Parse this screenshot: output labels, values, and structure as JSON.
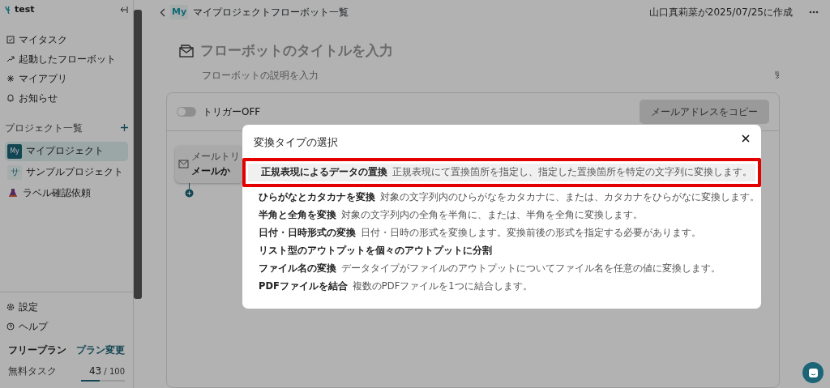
{
  "sidebar": {
    "workspace": "test",
    "nav": [
      {
        "label": "マイタスク"
      },
      {
        "label": "起動したフローボット"
      },
      {
        "label": "マイアプリ"
      },
      {
        "label": "お知らせ"
      }
    ],
    "projects_heading": "プロジェクト一覧",
    "projects": [
      {
        "kind": "badge",
        "badge": "My",
        "label": "マイプロジェクト",
        "selected": true
      },
      {
        "kind": "badge",
        "badge": "サ",
        "label": "サンプルプロジェクト",
        "selected": false
      },
      {
        "kind": "icon",
        "label": "ラベル確認依頼",
        "selected": false
      }
    ],
    "bottom": [
      {
        "label": "設定"
      },
      {
        "label": "ヘルプ"
      }
    ],
    "plan": {
      "name": "フリープラン",
      "link": "プラン変更",
      "quota_label": "無料タスク",
      "used": "43",
      "limit": "/ 100",
      "level": 0.43
    }
  },
  "header": {
    "badge": "My",
    "breadcrumb": "マイプロジェクトフローボット一覧",
    "created": "山口真莉菜が2025/07/25に作成"
  },
  "flowbot": {
    "title_placeholder": "フローボットのタイトルを入力",
    "description_placeholder": "フローボットの説明を入力",
    "trigger": {
      "label": "トリガーOFF",
      "on": false
    },
    "copy_button": "メールアドレスをコピー",
    "node": {
      "caption": "メールトリ",
      "title": "メールか"
    }
  },
  "modal": {
    "title": "変換タイプの選択",
    "items": [
      {
        "name": "正規表現によるデータの置換",
        "description": "正規表現にて置換箇所を指定し、指定した置換箇所を特定の文字列に変換します。",
        "selected": true,
        "highlighted": true
      },
      {
        "name": "ひらがなとカタカナを変換",
        "description": "対象の文字列内のひらがなをカタカナに、または、カタカナをひらがなに変換します。",
        "selected": false,
        "highlighted": false
      },
      {
        "name": "半角と全角を変換",
        "description": "対象の文字列内の全角を半角に、または、半角を全角に変換します。",
        "selected": false,
        "highlighted": false
      },
      {
        "name": "日付・日時形式の変換",
        "description": "日付・日時の形式を変換します。変換前後の形式を指定する必要があります。",
        "selected": false,
        "highlighted": false
      },
      {
        "name": "リスト型のアウトプットを個々のアウトプットに分割",
        "selected": false,
        "highlighted": false
      },
      {
        "name": "ファイル名の変換",
        "description": "データタイプがファイルのアウトプットについてファイル名を任意の値に変換します。",
        "selected": false,
        "highlighted": false
      },
      {
        "name": "PDFファイルを結合",
        "description": "複数のPDFファイルを1つに結合します。",
        "selected": false,
        "highlighted": false
      }
    ]
  }
}
